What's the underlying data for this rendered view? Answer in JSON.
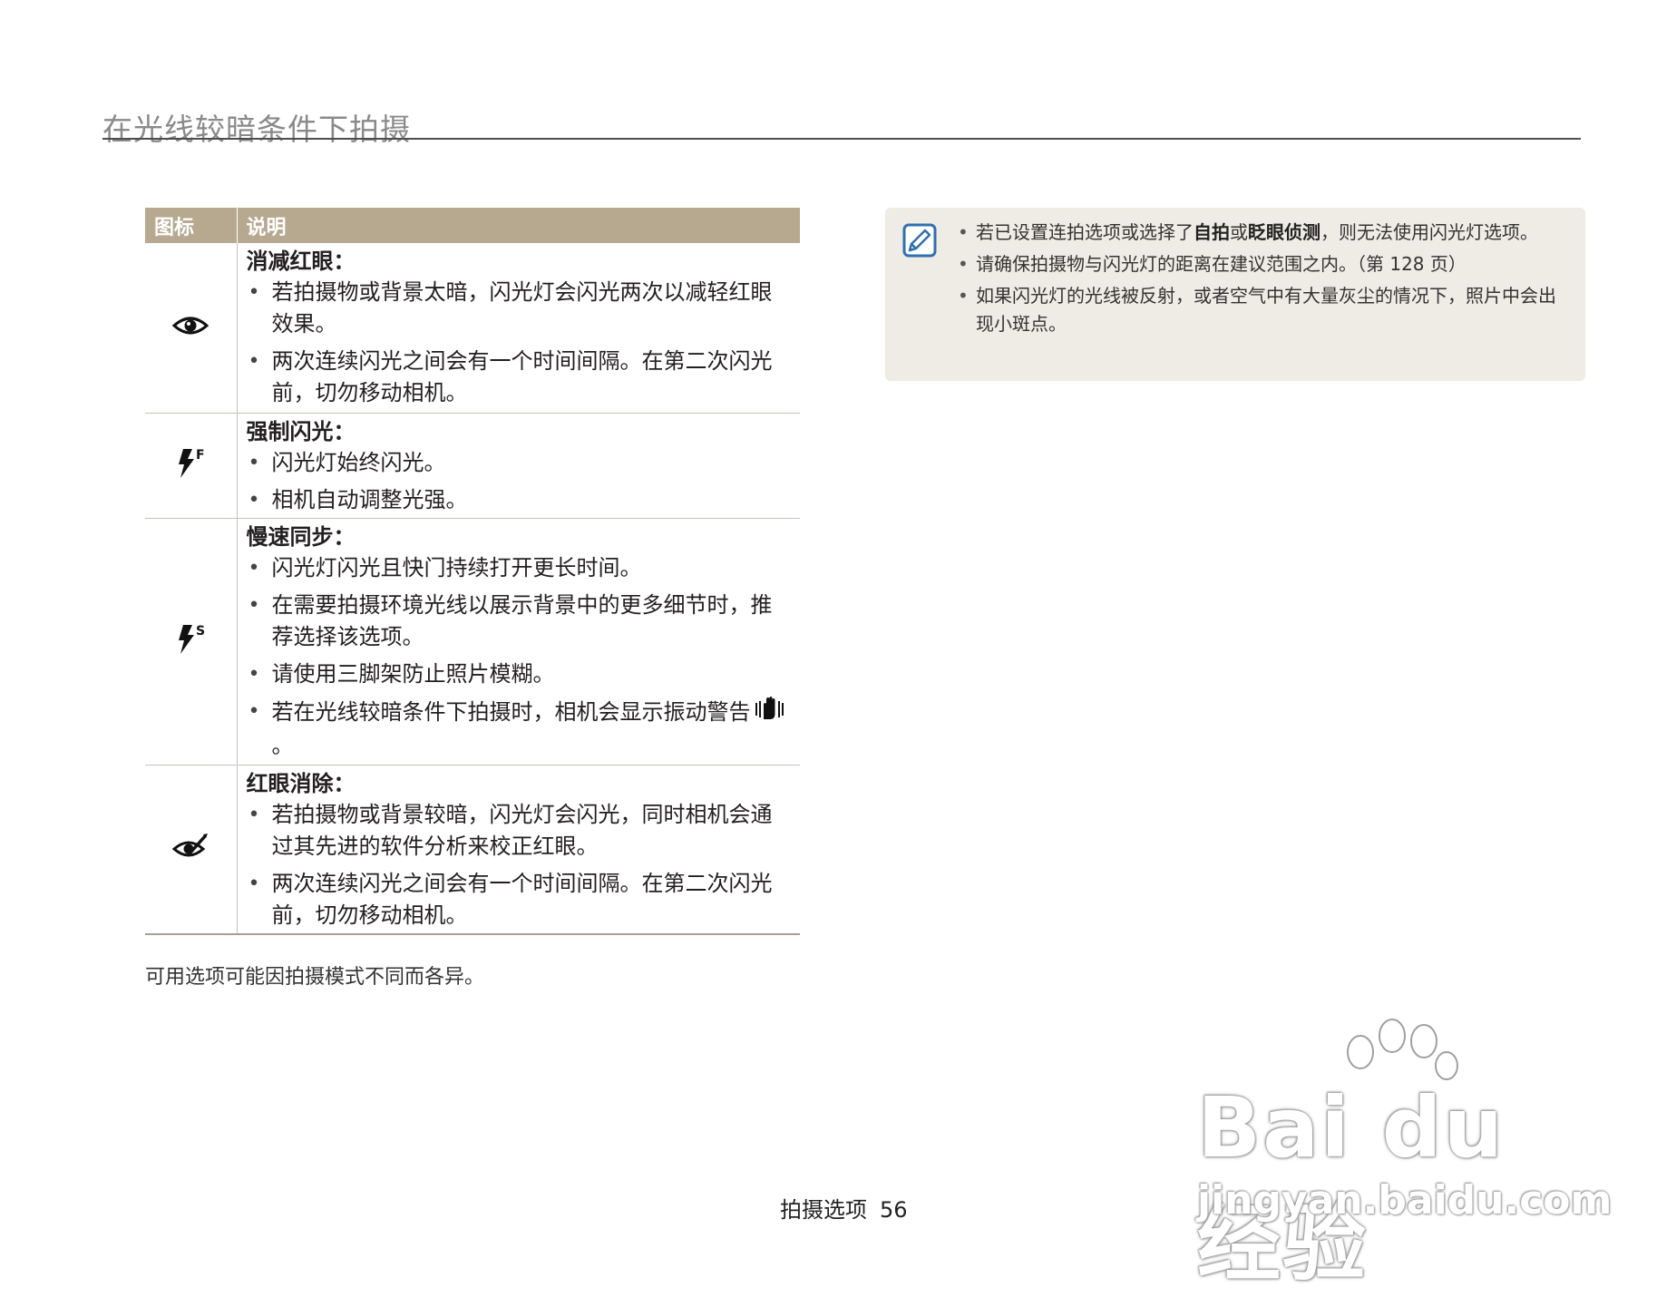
{
  "page_title": "在光线较暗条件下拍摄",
  "table": {
    "headers": {
      "icon": "图标",
      "description": "说明"
    },
    "rows": [
      {
        "icon": "red-eye-icon",
        "name": "消减红眼",
        "colon": "：",
        "bullets": [
          "若拍摄物或背景太暗，闪光灯会闪光两次以减轻红眼效果。",
          "两次连续闪光之间会有一个时间间隔。在第二次闪光前，切勿移动相机。"
        ]
      },
      {
        "icon": "fill-flash-icon",
        "icon_letter": "F",
        "name": "强制闪光",
        "colon": "：",
        "bullets": [
          "闪光灯始终闪光。",
          "相机自动调整光强。"
        ]
      },
      {
        "icon": "slow-sync-icon",
        "icon_letter": "S",
        "name": "慢速同步",
        "colon": "：",
        "bullets": [
          "闪光灯闪光且快门持续打开更长时间。",
          "在需要拍摄环境光线以展示背景中的更多细节时，推荐选择该选项。",
          "请使用三脚架防止照片模糊。",
          "若在光线较暗条件下拍摄时，相机会显示振动警告"
        ],
        "warning_tail": "。"
      },
      {
        "icon": "red-eye-fix-icon",
        "name": "红眼消除",
        "colon": "：",
        "bullets": [
          "若拍摄物或背景较暗，闪光灯会闪光，同时相机会通过其先进的软件分析来校正红眼。",
          "两次连续闪光之间会有一个时间间隔。在第二次闪光前，切勿移动相机。"
        ]
      }
    ]
  },
  "table_note": "可用选项可能因拍摄模式不同而各异。",
  "note_box": {
    "icon": "note-pencil-icon",
    "item1_pre": "若已设置连拍选项或选择了",
    "item1_bold1": "自拍",
    "item1_mid": "或",
    "item1_bold2": "眨眼侦测",
    "item1_post": "，则无法使用闪光灯选项。",
    "item2": "请确保拍摄物与闪光灯的距离在建议范围之内。（第 128 页）",
    "item3": "如果闪光灯的光线被反射，或者空气中有大量灰尘的情况下，照片中会出现小斑点。"
  },
  "footer": {
    "section": "拍摄选项",
    "page_number": "56"
  },
  "watermark": {
    "main": "Bai du 经验",
    "sub": "jingyan.baidu.com"
  }
}
